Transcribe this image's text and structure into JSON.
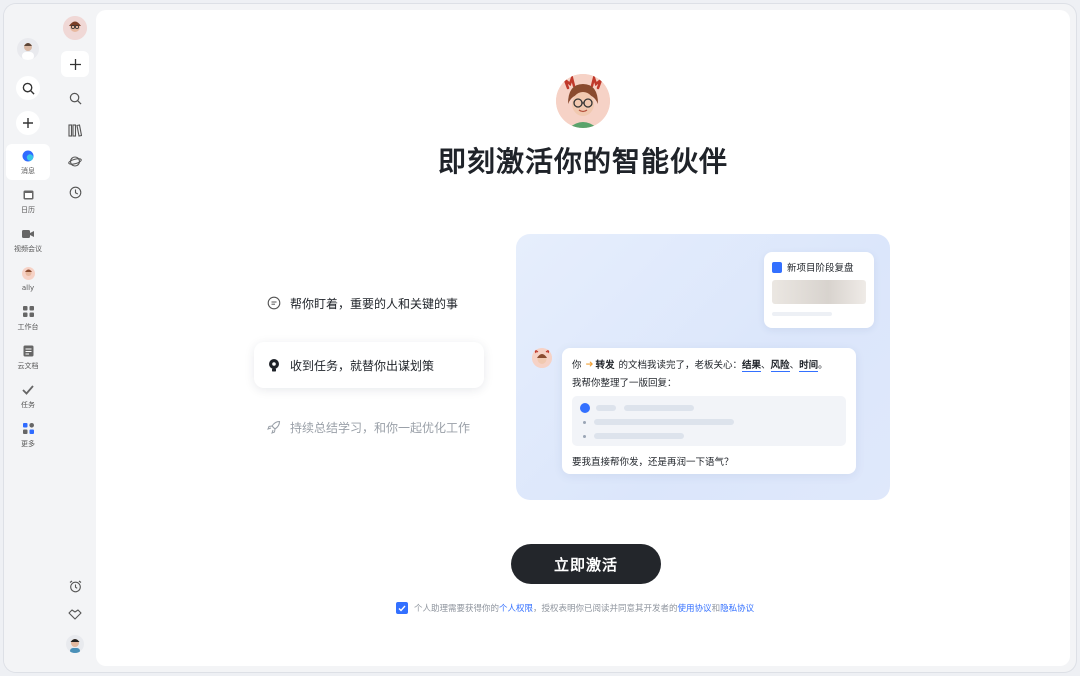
{
  "rail1": {
    "nav": [
      {
        "label": "消息",
        "icon": "message-icon",
        "active": true
      },
      {
        "label": "日历",
        "icon": "calendar-icon",
        "active": false
      },
      {
        "label": "视频会议",
        "icon": "video-icon",
        "active": false
      },
      {
        "label": "ally",
        "icon": "ally-avatar-icon",
        "active": false
      },
      {
        "label": "工作台",
        "icon": "workbench-icon",
        "active": false
      },
      {
        "label": "云文档",
        "icon": "cloud-doc-icon",
        "active": false
      },
      {
        "label": "任务",
        "icon": "task-icon",
        "active": false
      },
      {
        "label": "更多",
        "icon": "more-icon",
        "active": false
      }
    ]
  },
  "hero": {
    "title": "即刻激活你的智能伙伴"
  },
  "features": [
    {
      "label": "帮你盯着，重要的人和关键的事",
      "icon": "chat-bubble-icon",
      "state": "normal"
    },
    {
      "label": "收到任务，就替你出谋划策",
      "icon": "lightbulb-icon",
      "state": "active"
    },
    {
      "label": "持续总结学习，和你一起优化工作",
      "icon": "rocket-icon",
      "state": "dim"
    }
  ],
  "preview": {
    "doc_title": "新项目阶段复盘",
    "msg_you": "你",
    "msg_forward": "转发",
    "msg_mid": "的文档我读完了，老板关心：",
    "kw1": "结果",
    "kw2": "风险",
    "kw3": "时间",
    "sep": "、",
    "end": "。",
    "msg_line2": "我帮你整理了一版回复：",
    "msg_line3": "要我直接帮你发，还是再润一下语气？"
  },
  "cta": {
    "label": "立即激活"
  },
  "consent": {
    "part1": "个人助理需要获得你的",
    "link1": "个人权限",
    "part2": "，授权表明你已阅读并同意其开发者的",
    "link2": "使用协议",
    "part3": "和",
    "link3": "隐私协议",
    "checked": true
  },
  "colors": {
    "accent": "#3370ff",
    "cta_bg": "#23262b"
  }
}
